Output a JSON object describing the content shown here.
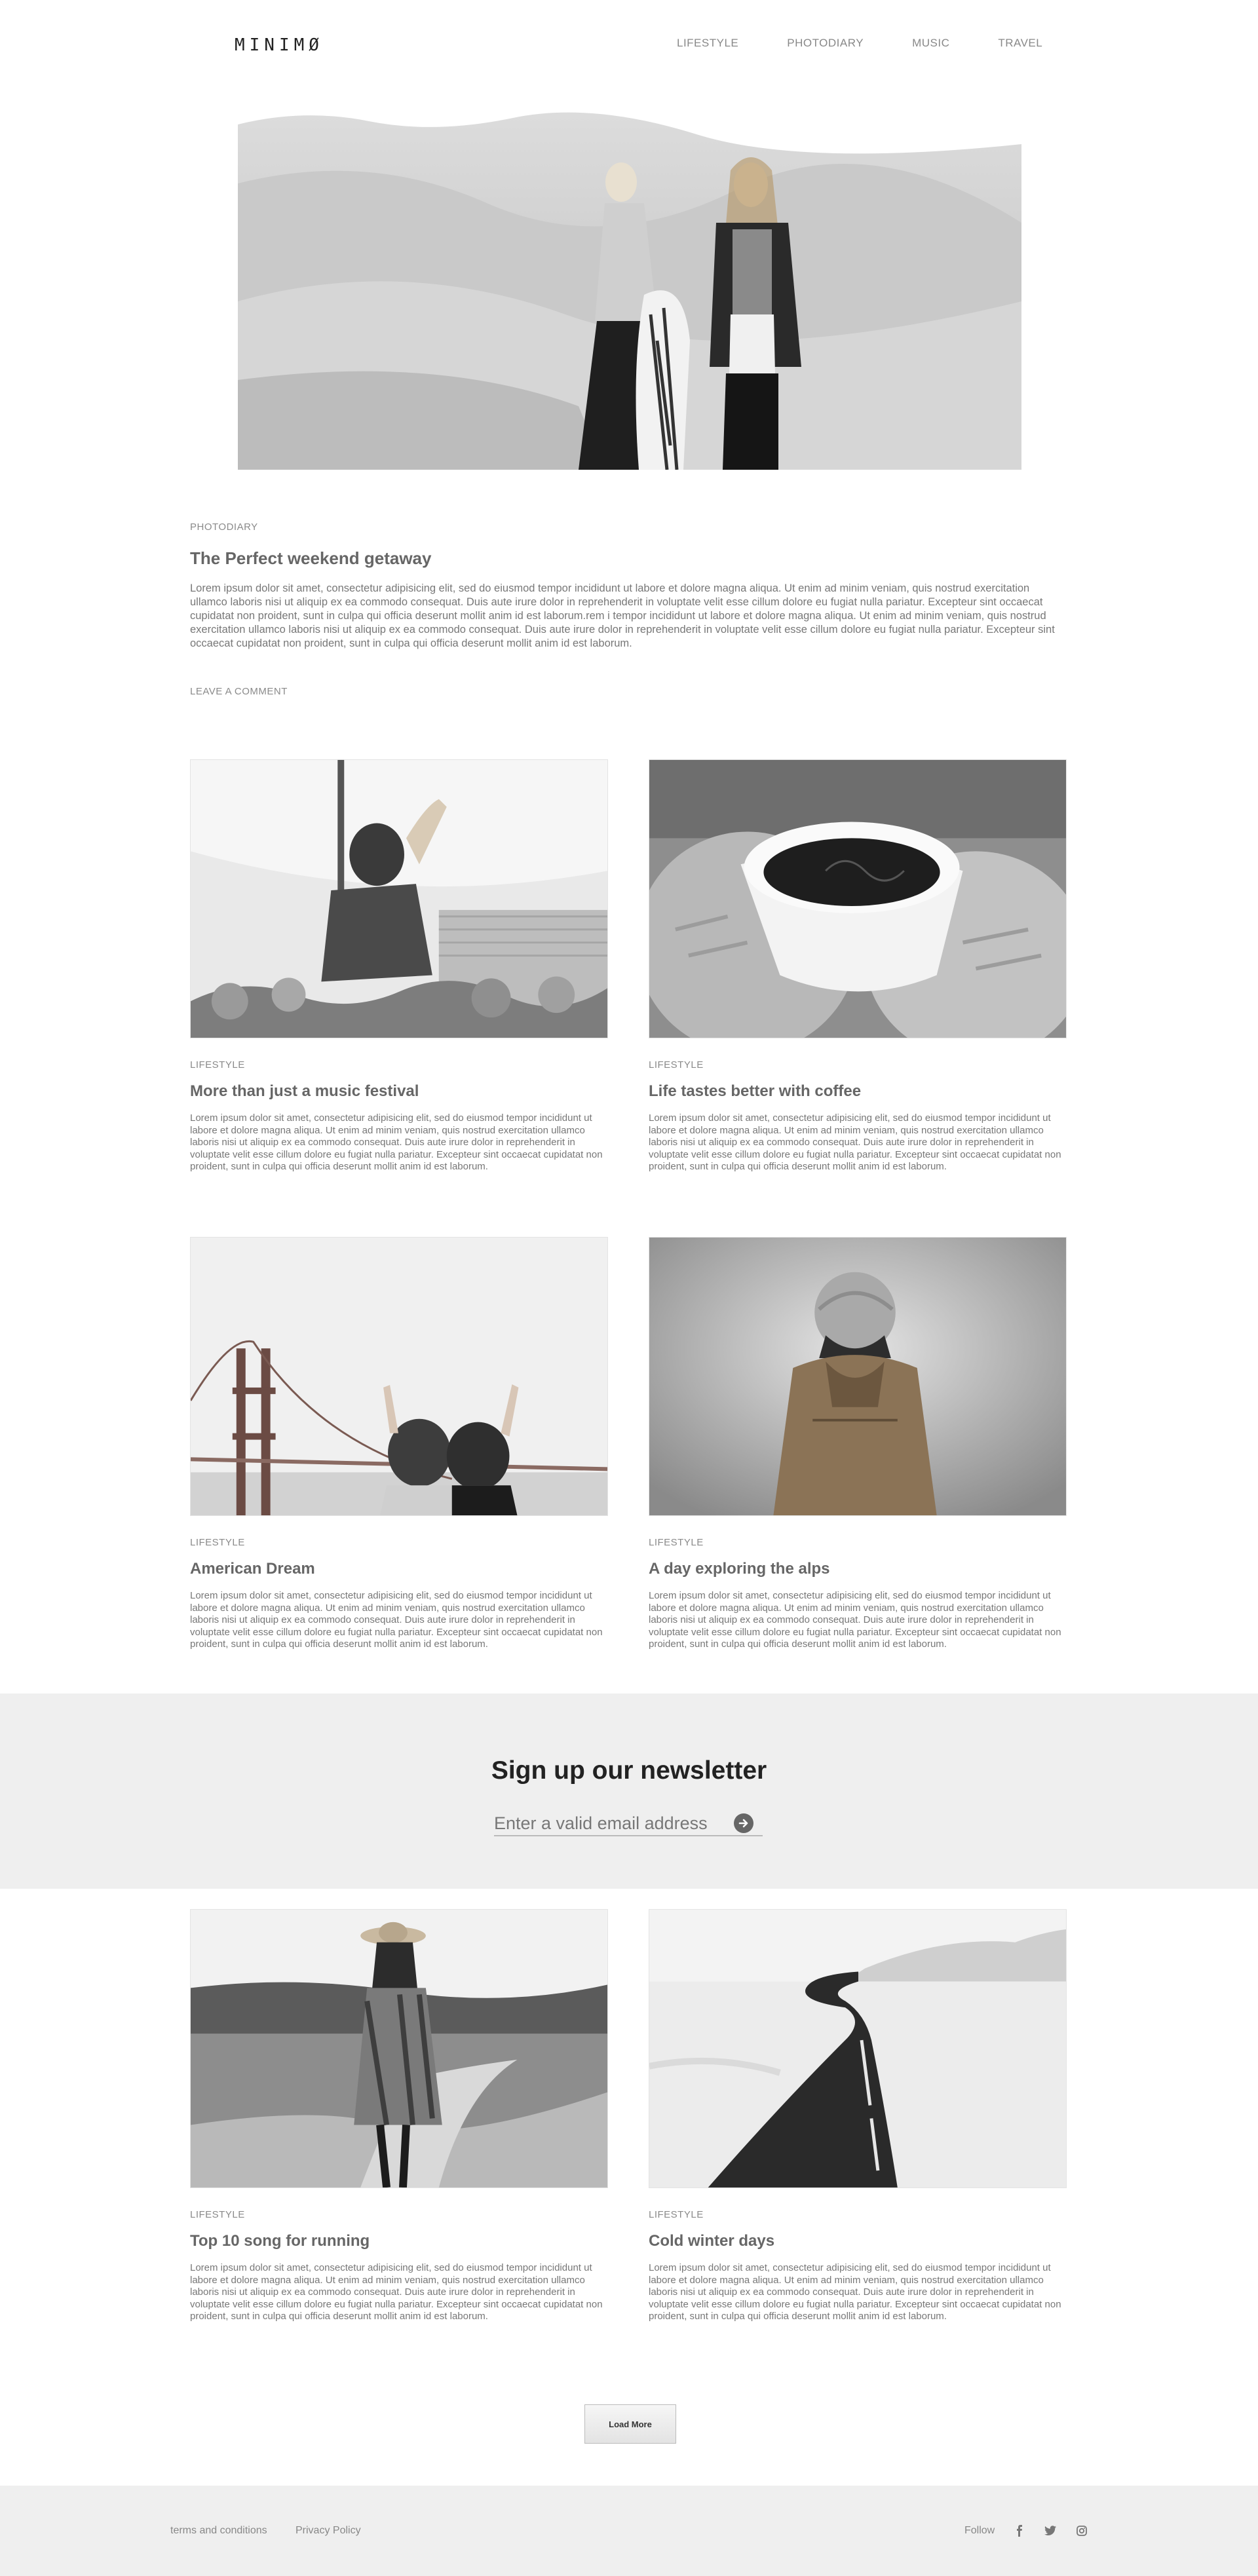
{
  "header": {
    "logo": "MINIMØ",
    "nav": [
      "LIFESTYLE",
      "PHOTODIARY",
      "MUSIC",
      "TRAVEL"
    ]
  },
  "featured": {
    "category": "PHOTODIARY",
    "title": "The Perfect weekend getaway",
    "body": "Lorem ipsum dolor sit amet, consectetur adipisicing elit, sed do eiusmod tempor incididunt ut labore et dolore magna aliqua. Ut enim ad minim veniam, quis nostrud exercitation ullamco laboris nisi ut aliquip ex ea commodo consequat. Duis aute irure dolor in reprehenderit in voluptate velit esse cillum dolore eu fugiat nulla pariatur. Excepteur sint occaecat cupidatat non proident, sunt in culpa qui officia deserunt mollit anim id est laborum.rem i tempor incididunt ut labore et dolore magna aliqua. Ut enim ad minim veniam, quis nostrud exercitation ullamco laboris nisi ut aliquip ex ea commodo consequat. Duis aute irure dolor in reprehenderit in voluptate velit esse cillum dolore eu fugiat nulla pariatur. Excepteur sint occaecat cupidatat non proident, sunt in culpa qui officia deserunt mollit anim id est laborum.",
    "comment_link": "LEAVE A COMMENT"
  },
  "posts": [
    {
      "category": "LIFESTYLE",
      "title": "More than just a music festival",
      "body": "Lorem ipsum dolor sit amet, consectetur adipisicing elit, sed do eiusmod tempor incididunt ut labore et dolore magna aliqua. Ut enim ad minim veniam, quis nostrud exercitation ullamco laboris nisi ut aliquip ex ea commodo consequat. Duis aute irure dolor in reprehenderit in voluptate velit esse cillum dolore eu fugiat nulla pariatur. Excepteur sint occaecat cupidatat non proident, sunt in culpa qui officia deserunt mollit anim id est laborum."
    },
    {
      "category": "LIFESTYLE",
      "title": "Life tastes better with coffee",
      "body": "Lorem ipsum dolor sit amet, consectetur adipisicing elit, sed do eiusmod tempor incididunt ut labore et dolore magna aliqua. Ut enim ad minim veniam, quis nostrud exercitation ullamco laboris nisi ut aliquip ex ea commodo consequat. Duis aute irure dolor in reprehenderit in voluptate velit esse cillum dolore eu fugiat nulla pariatur. Excepteur sint occaecat cupidatat non proident, sunt in culpa qui officia deserunt mollit anim id est laborum."
    },
    {
      "category": "LIFESTYLE",
      "title": "American Dream",
      "body": "Lorem ipsum dolor sit amet, consectetur adipisicing elit, sed do eiusmod tempor incididunt ut labore et dolore magna aliqua. Ut enim ad minim veniam, quis nostrud exercitation ullamco laboris nisi ut aliquip ex ea commodo consequat. Duis aute irure dolor in reprehenderit in voluptate velit esse cillum dolore eu fugiat nulla pariatur. Excepteur sint occaecat cupidatat non proident, sunt in culpa qui officia deserunt mollit anim id est laborum."
    },
    {
      "category": "LIFESTYLE",
      "title": "A day exploring the alps",
      "body": "Lorem ipsum dolor sit amet, consectetur adipisicing elit, sed do eiusmod tempor incididunt ut labore et dolore magna aliqua. Ut enim ad minim veniam, quis nostrud exercitation ullamco laboris nisi ut aliquip ex ea commodo consequat. Duis aute irure dolor in reprehenderit in voluptate velit esse cillum dolore eu fugiat nulla pariatur. Excepteur sint occaecat cupidatat non proident, sunt in culpa qui officia deserunt mollit anim id est laborum."
    },
    {
      "category": "LIFESTYLE",
      "title": "Top 10 song for running",
      "body": "Lorem ipsum dolor sit amet, consectetur adipisicing elit, sed do eiusmod tempor incididunt ut labore et dolore magna aliqua. Ut enim ad minim veniam, quis nostrud exercitation ullamco laboris nisi ut aliquip ex ea commodo consequat. Duis aute irure dolor in reprehenderit in voluptate velit esse cillum dolore eu fugiat nulla pariatur. Excepteur sint occaecat cupidatat non proident, sunt in culpa qui officia deserunt mollit anim id est laborum."
    },
    {
      "category": "LIFESTYLE",
      "title": "Cold winter days",
      "body": "Lorem ipsum dolor sit amet, consectetur adipisicing elit, sed do eiusmod tempor incididunt ut labore et dolore magna aliqua. Ut enim ad minim veniam, quis nostrud exercitation ullamco laboris nisi ut aliquip ex ea commodo consequat. Duis aute irure dolor in reprehenderit in voluptate velit esse cillum dolore eu fugiat nulla pariatur. Excepteur sint occaecat cupidatat non proident, sunt in culpa qui officia deserunt mollit anim id est laborum."
    }
  ],
  "newsletter": {
    "title": "Sign up our newsletter",
    "placeholder": "Enter a valid email address",
    "submit_icon": "arrow-circle-right-icon"
  },
  "load_more": "Load More",
  "footer": {
    "links": [
      "terms and conditions",
      "Privacy Policy"
    ],
    "follow": "Follow",
    "social_icons": [
      "facebook-icon",
      "twitter-icon",
      "instagram-icon"
    ]
  }
}
